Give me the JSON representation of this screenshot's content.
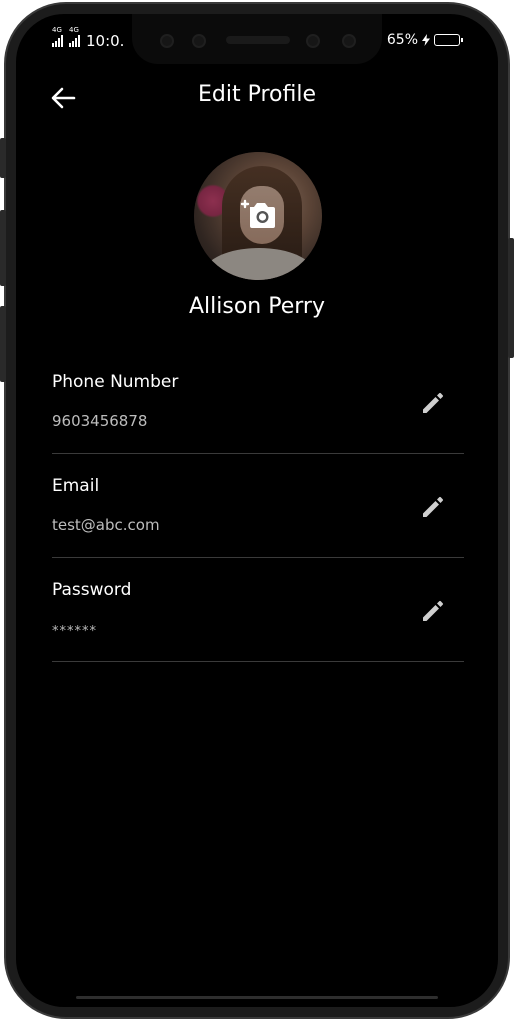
{
  "status_bar": {
    "net1": "4G",
    "net2": "4G",
    "time": "10:0.",
    "battery": "65%"
  },
  "header": {
    "title": "Edit Profile"
  },
  "profile": {
    "name": "Allison Perry"
  },
  "fields": [
    {
      "label": "Phone Number",
      "value": "9603456878"
    },
    {
      "label": "Email",
      "value": "test@abc.com"
    },
    {
      "label": "Password",
      "value": "******"
    }
  ],
  "icons": {
    "back": "arrow-left-icon",
    "camera": "add-photo-icon",
    "edit": "pencil-icon"
  },
  "colors": {
    "background": "#000000",
    "text": "#ffffff",
    "muted": "#bdbdbd",
    "divider": "#3a3a3a",
    "icon": "#cfcfcf"
  }
}
